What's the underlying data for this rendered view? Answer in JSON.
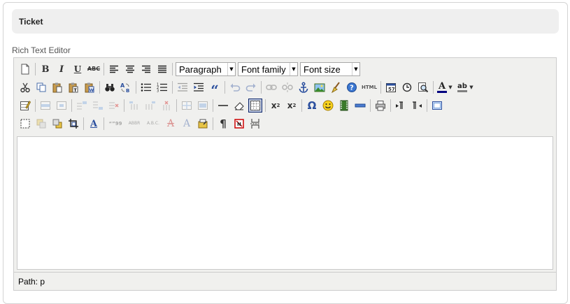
{
  "page": {
    "title": "Ticket"
  },
  "editor": {
    "label": "Rich Text Editor",
    "path_label": "Path:",
    "path_value": "p",
    "content": ""
  },
  "toolbar": {
    "row1": {
      "bold": "B",
      "italic": "I",
      "underline": "U",
      "strikethrough": "ABC",
      "format_select": "Paragraph",
      "font_family_select": "Font family",
      "font_size_select": "Font size"
    },
    "row2": {
      "blockquote": "“",
      "html": "HTML",
      "forecolor": "A",
      "backcolor": "ab"
    },
    "row3": {
      "subscript_base": "x",
      "subscript": "2",
      "superscript_base": "x",
      "superscript": "2",
      "charmap": "Ω"
    },
    "row4": {
      "styleprops": "A",
      "cite": "“”99",
      "abbr": "ABBR",
      "acronym": "A.B.C.",
      "del": "A",
      "ins": "A",
      "visualchars": "¶"
    }
  },
  "colors": {
    "header_bg": "#efefef",
    "toolbar_bg": "#f0f0ee",
    "active_border": "#0a246a",
    "active_bg": "#c2cbe0"
  },
  "icons": {
    "new_document": "new-document-icon",
    "cut": "cut-icon",
    "anchor": "anchor-icon",
    "smiley": "emoticon-icon",
    "print": "print-icon",
    "fullscreen": "fullscreen-icon"
  }
}
